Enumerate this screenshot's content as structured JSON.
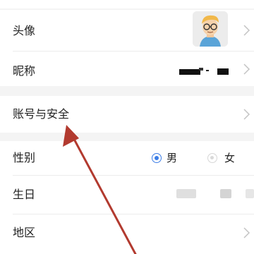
{
  "profile": {
    "avatar_label": "头像",
    "nickname_label": "昵称",
    "account_security_label": "账号与安全",
    "gender_label": "性别",
    "gender_options": [
      "男",
      "女"
    ],
    "gender_selected": "男",
    "birthday_label": "生日",
    "region_label": "地区"
  },
  "icons": {
    "chevron": "chevron-right-icon",
    "avatar": "cartoon-avatar-image",
    "annotation": "red-arrow-annotation"
  },
  "colors": {
    "accent": "#3b7de6",
    "annotation": "#b23a2f"
  }
}
